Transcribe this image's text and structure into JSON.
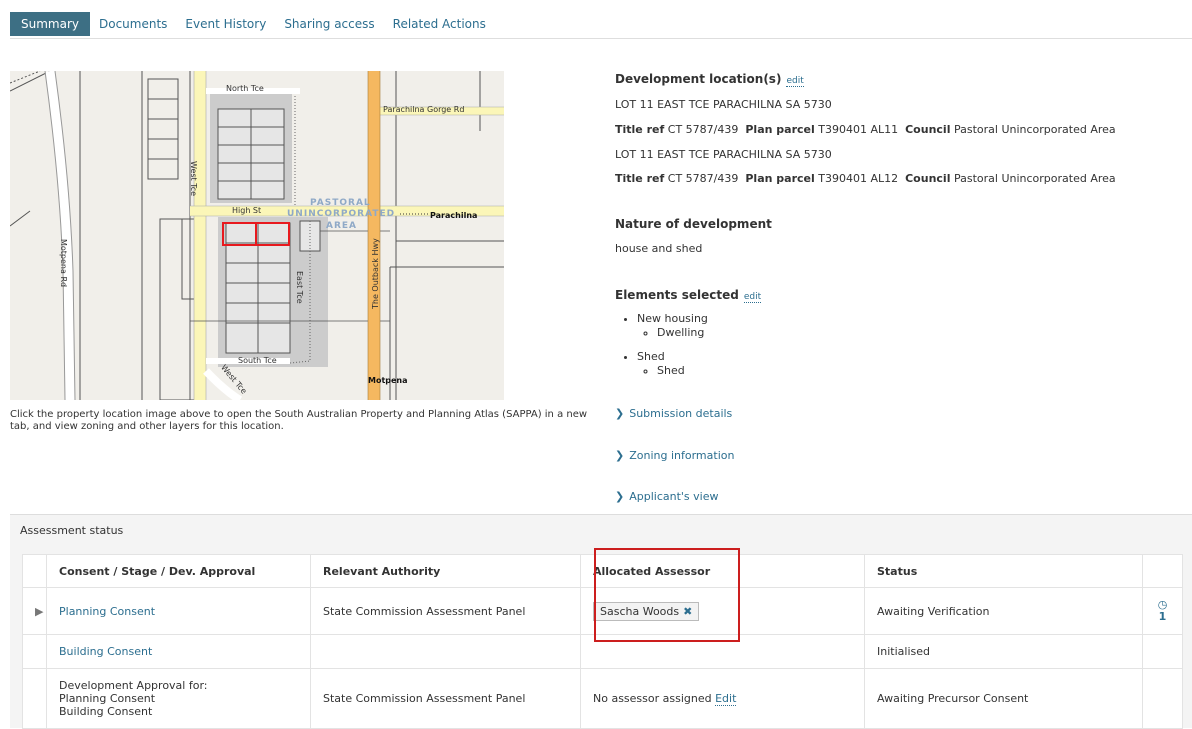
{
  "tabs": [
    {
      "label": "Summary",
      "active": true
    },
    {
      "label": "Documents"
    },
    {
      "label": "Event History"
    },
    {
      "label": "Sharing access"
    },
    {
      "label": "Related Actions"
    }
  ],
  "map": {
    "labels": {
      "north_tce": "North Tce",
      "parachilna_gorge_rd": "Parachilna Gorge Rd",
      "west_tce": "West Tce",
      "high_st": "High St",
      "pastoral": "PASTORAL",
      "unincorporated": "UNINCORPORATED",
      "area": "AREA",
      "parachilna": "Parachilna",
      "motpena_rd": "Motpena Rd",
      "the_outback_hwy": "The Outback Hwy",
      "east_tce": "East Tce",
      "south_tce": "South Tce",
      "west_tce_2": "West Tce",
      "motpena": "Motpena"
    },
    "caption": "Click the property location image above to open the South Australian Property and Planning Atlas (SAPPA) in a new tab, and view zoning and other layers for this location."
  },
  "details": {
    "dev_location_heading": "Development location(s)",
    "edit": "edit",
    "locations": [
      {
        "address": "LOT 11 EAST TCE PARACHILNA SA 5730",
        "title_ref_label": "Title ref",
        "title_ref": "CT 5787/439",
        "plan_parcel_label": "Plan parcel",
        "plan_parcel": "T390401 AL11",
        "council_label": "Council",
        "council": "Pastoral Unincorporated Area"
      },
      {
        "address": "LOT 11 EAST TCE PARACHILNA SA 5730",
        "title_ref_label": "Title ref",
        "title_ref": "CT 5787/439",
        "plan_parcel_label": "Plan parcel",
        "plan_parcel": "T390401 AL12",
        "council_label": "Council",
        "council": "Pastoral Unincorporated Area"
      }
    ],
    "nature_heading": "Nature of development",
    "nature_value": "house and shed",
    "elements_heading": "Elements selected",
    "elements": [
      {
        "label": "New housing",
        "sub": "Dwelling"
      },
      {
        "label": "Shed",
        "sub": "Shed"
      }
    ],
    "expanders": [
      "Submission details",
      "Zoning information",
      "Applicant's view"
    ]
  },
  "assessment": {
    "title": "Assessment status",
    "headers": [
      "Consent / Stage / Dev. Approval",
      "Relevant Authority",
      "Allocated Assessor",
      "Status"
    ],
    "rows": [
      {
        "consent": "Planning Consent",
        "authority": "State Commission Assessment Panel",
        "assessor": "Sascha Woods",
        "status": "Awaiting Verification",
        "count": "1"
      },
      {
        "consent": "Building Consent",
        "authority": "",
        "assessor": "",
        "status": "Initialised"
      },
      {
        "consent_lines": [
          "Development Approval for:",
          "Planning Consent",
          "Building Consent"
        ],
        "authority": "State Commission Assessment Panel",
        "assessor_text": "No assessor assigned",
        "assessor_edit": "Edit",
        "status": "Awaiting Precursor Consent"
      }
    ]
  },
  "colors": {
    "accent": "#3d6f84",
    "link": "#2c6e8f",
    "highlight": "#cc1e1e",
    "highway": "#f5b860",
    "road_minor": "#fbf6b8"
  },
  "icons": {
    "expand_row": "triangle-right-icon",
    "remove_assessor": "x-icon",
    "history": "clock-icon",
    "expander": "chevron-right-icon"
  }
}
